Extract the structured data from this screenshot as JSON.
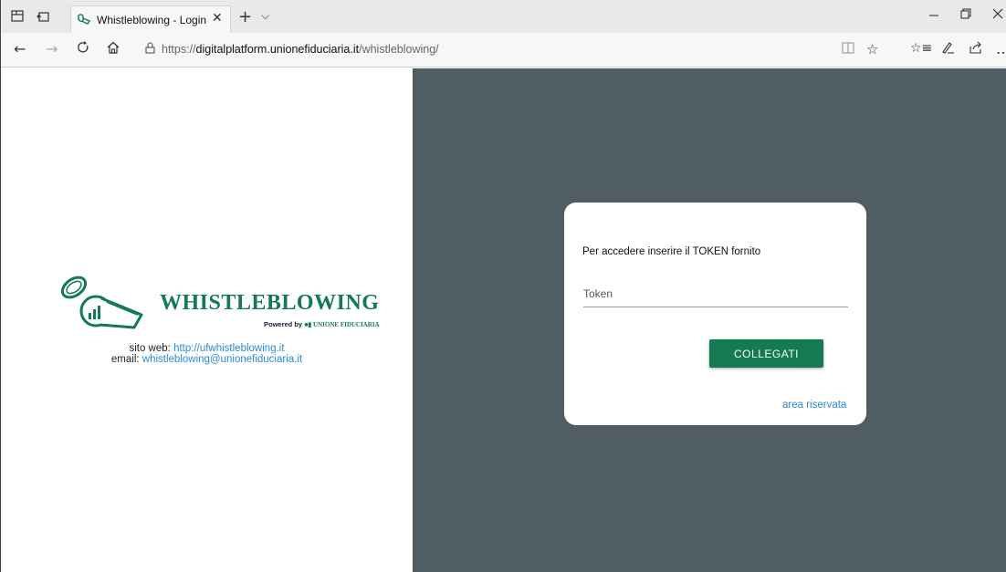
{
  "browser": {
    "tab_title": "Whistleblowing - Login",
    "close_tab_glyph": "✕",
    "new_tab_glyph": "+",
    "tab_menu_glyph": "⌵",
    "url_scheme": "https://",
    "url_host": "digitalplatform.unionefiduciaria.it",
    "url_path": "/whistleblowing/",
    "icons": [
      "tab-preview-icon",
      "set-tabs-aside-icon",
      "back-icon",
      "forward-icon",
      "refresh-icon",
      "home-icon",
      "lock-icon",
      "reading-view-icon",
      "favorite-star-icon",
      "favorites-hub-icon",
      "pen-icon",
      "share-icon",
      "more-icon",
      "minimize-icon",
      "restore-icon",
      "close-window-icon"
    ]
  },
  "brand": {
    "logo_word": "WHISTLEBLOWING",
    "powered_by": "Powered by",
    "powered_brand_line1": "UNIONE",
    "powered_brand_line2": "FIDUCIARIA",
    "color": "#137a52"
  },
  "info": {
    "site_label": "sito web:",
    "site_link": "http://ufwhistleblowing.it",
    "email_label": "email:",
    "email_link": "whistleblowing@unionefiduciaria.it"
  },
  "login": {
    "message": "Per accedere inserire il TOKEN fornito",
    "token_placeholder": "Token",
    "token_value": "",
    "button_label": "COLLEGATI",
    "reserved_link": "area riservata"
  },
  "colors": {
    "right_panel": "#505d62",
    "button": "#137a52",
    "link": "#2a8ad6"
  }
}
